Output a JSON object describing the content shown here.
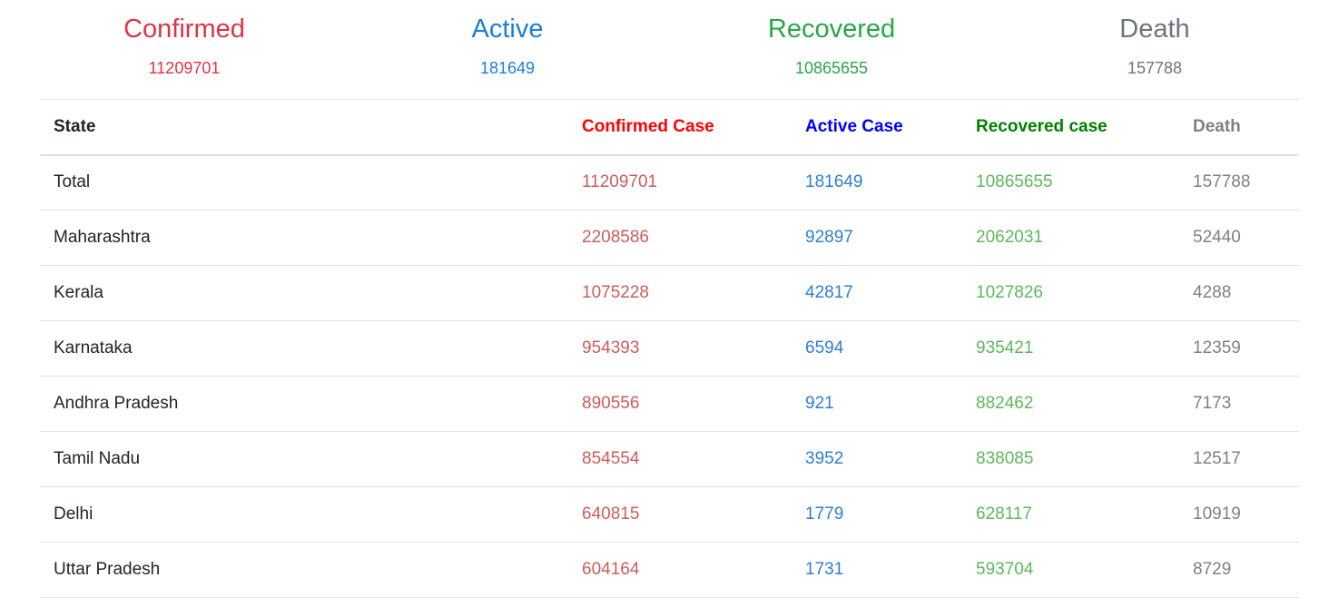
{
  "summary": {
    "confirmed": {
      "title": "Confirmed",
      "value": "11209701"
    },
    "active": {
      "title": "Active",
      "value": "181649"
    },
    "recovered": {
      "title": "Recovered",
      "value": "10865655"
    },
    "death": {
      "title": "Death",
      "value": "157788"
    }
  },
  "table": {
    "headers": {
      "state": "State",
      "confirmed": "Confirmed Case",
      "active": "Active Case",
      "recovered": "Recovered case",
      "death": "Death"
    },
    "rows": [
      {
        "state": "Total",
        "confirmed": "11209701",
        "active": "181649",
        "recovered": "10865655",
        "death": "157788"
      },
      {
        "state": "Maharashtra",
        "confirmed": "2208586",
        "active": "92897",
        "recovered": "2062031",
        "death": "52440"
      },
      {
        "state": "Kerala",
        "confirmed": "1075228",
        "active": "42817",
        "recovered": "1027826",
        "death": "4288"
      },
      {
        "state": "Karnataka",
        "confirmed": "954393",
        "active": "6594",
        "recovered": "935421",
        "death": "12359"
      },
      {
        "state": "Andhra Pradesh",
        "confirmed": "890556",
        "active": "921",
        "recovered": "882462",
        "death": "7173"
      },
      {
        "state": "Tamil Nadu",
        "confirmed": "854554",
        "active": "3952",
        "recovered": "838085",
        "death": "12517"
      },
      {
        "state": "Delhi",
        "confirmed": "640815",
        "active": "1779",
        "recovered": "628117",
        "death": "10919"
      },
      {
        "state": "Uttar Pradesh",
        "confirmed": "604164",
        "active": "1731",
        "recovered": "593704",
        "death": "8729"
      }
    ]
  },
  "colors": {
    "confirmed": "#dc3545",
    "active": "#1a7fd9",
    "recovered": "#28a745",
    "death": "#6c757d"
  }
}
